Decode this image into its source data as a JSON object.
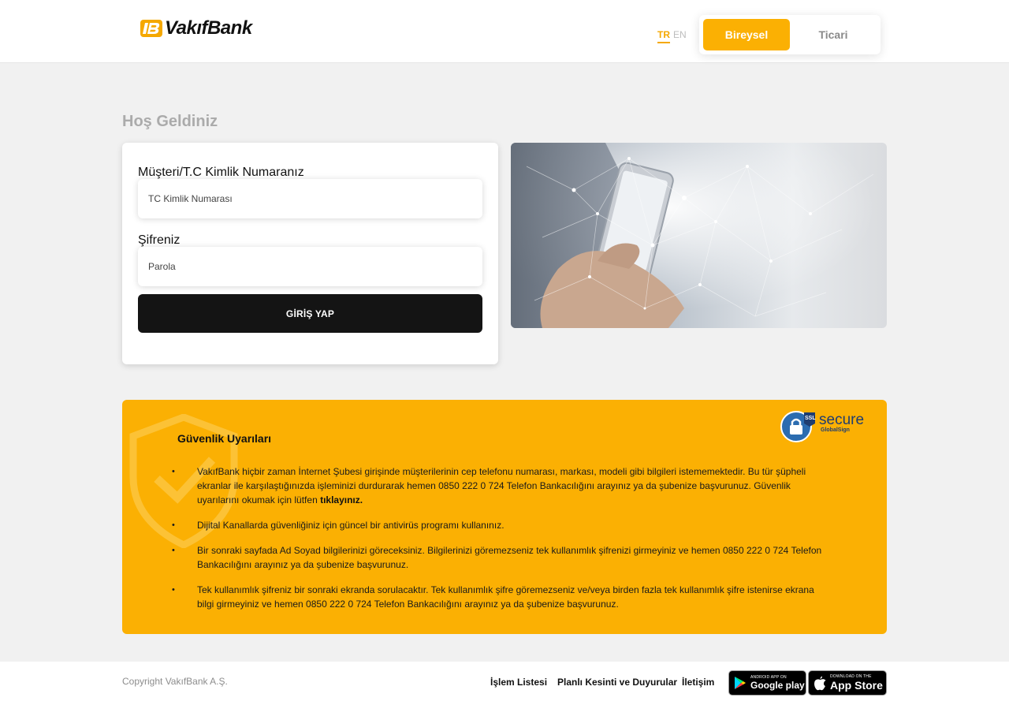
{
  "header": {
    "logo_text": "VakıfBank",
    "lang_tr": "TR",
    "lang_en": "EN",
    "segment_personal": "Bireysel",
    "segment_business": "Ticari"
  },
  "main": {
    "welcome": "Hoş Geldiniz",
    "customer_label": "Müşteri/T.C Kimlik Numaranız",
    "customer_placeholder": "TC Kimlik Numarası",
    "password_label": "Şifreniz",
    "password_placeholder": "Parola",
    "login_button": "GİRİŞ YAP"
  },
  "warnings": {
    "title": "Güvenlik Uyarıları",
    "ssl_badge": "secure",
    "ssl_tag": "SSL",
    "ssl_provider": "GlobalSign",
    "item1_text": "VakıfBank hiçbir zaman İnternet Şubesi girişinde müşterilerinin cep telefonu numarası, markası, modeli gibi bilgileri istememektedir. Bu tür şüpheli ekranlar ile karşılaştığınızda işleminizi durdurarak hemen 0850 222 0 724 Telefon Bankacılığını arayınız ya da şubenize başvurunuz. Güvenlik uyarılarını okumak için lütfen ",
    "item1_link": "tıklayınız.",
    "item2": "Dijital Kanallarda güvenliğiniz için güncel bir antivirüs programı kullanınız.",
    "item3": "Bir sonraki sayfada Ad Soyad bilgilerinizi göreceksiniz. Bilgilerinizi göremezseniz tek kullanımlık şifrenizi girmeyiniz ve hemen 0850 222 0 724 Telefon Bankacılığını arayınız ya da şubenize başvurunuz.",
    "item4": "Tek kullanımlık şifreniz bir sonraki ekranda sorulacaktır. Tek kullanımlık şifre göremezseniz ve/veya birden fazla tek kullanımlık şifre istenirse ekrana bilgi girmeyiniz ve hemen 0850 222 0 724 Telefon Bankacılığını arayınız ya da şubenize başvurunuz."
  },
  "footer": {
    "copyright": "Copyright VakıfBank A.Ş.",
    "link_transactions": "İşlem Listesi",
    "link_outages": "Planlı Kesinti ve Duyurular",
    "link_contact": "İletişim",
    "google_small": "Android app on",
    "google_big": "Google play",
    "apple_small": "Download on the",
    "apple_big": "App Store"
  },
  "colors": {
    "brand_yellow": "#fbb003",
    "dark_button": "#141414",
    "background": "#f1f1f1"
  }
}
